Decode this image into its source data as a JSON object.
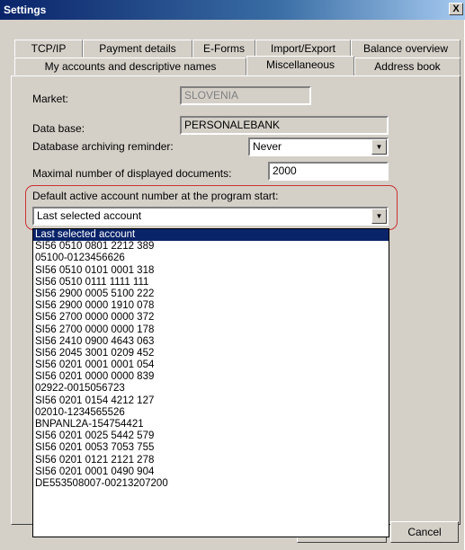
{
  "window": {
    "title": "Settings",
    "close_label": "X"
  },
  "tabs_row1": [
    "TCP/IP",
    "Payment details",
    "E-Forms",
    "Import/Export",
    "Balance overview"
  ],
  "tabs_row2": [
    "My accounts and descriptive names",
    "Miscellaneous",
    "Address book"
  ],
  "active_tab": "Miscellaneous",
  "fields": {
    "market_label": "Market:",
    "market_value": "SLOVENIA",
    "database_label": "Data base:",
    "database_value": "PERSONALEBANK",
    "archiving_label": "Database archiving reminder:",
    "archiving_value": "Never",
    "max_docs_label": "Maximal number of displayed documents:",
    "max_docs_value": "2000",
    "default_account_label": "Default active account number at the program start:",
    "default_account_value": "Last selected account"
  },
  "dropdown_items": [
    "Last selected account",
    "SI56 0510 0801 2212 389",
    "05100-0123456626",
    "SI56 0510 0101 0001 318",
    "SI56 0510 0111 1111 111",
    "SI56 2900 0005 5100 222",
    "SI56 2900 0000 1910 078",
    "SI56 2700 0000 0000 372",
    "SI56 2700 0000 0000 178",
    "SI56 2410 0900 4643 063",
    "SI56 2045 3001 0209 452",
    "SI56 0201 0001 0001 054",
    "SI56 0201 0000 0000 839",
    "02922-0015056723",
    "SI56 0201 0154 4212 127",
    "02010-1234565526",
    "BNPANL2A-154754421",
    "SI56 0201 0025 5442 579",
    "SI56 0201 0053 7053 755",
    "SI56 0201 0121 2121 278",
    "SI56 0201 0001 0490 904",
    "DE553508007-00213207200"
  ],
  "buttons": {
    "cancel": "Cancel"
  },
  "colors": {
    "titlebar": "#0a246a",
    "selection": "#0a246a",
    "highlight_ring": "#c83232"
  }
}
